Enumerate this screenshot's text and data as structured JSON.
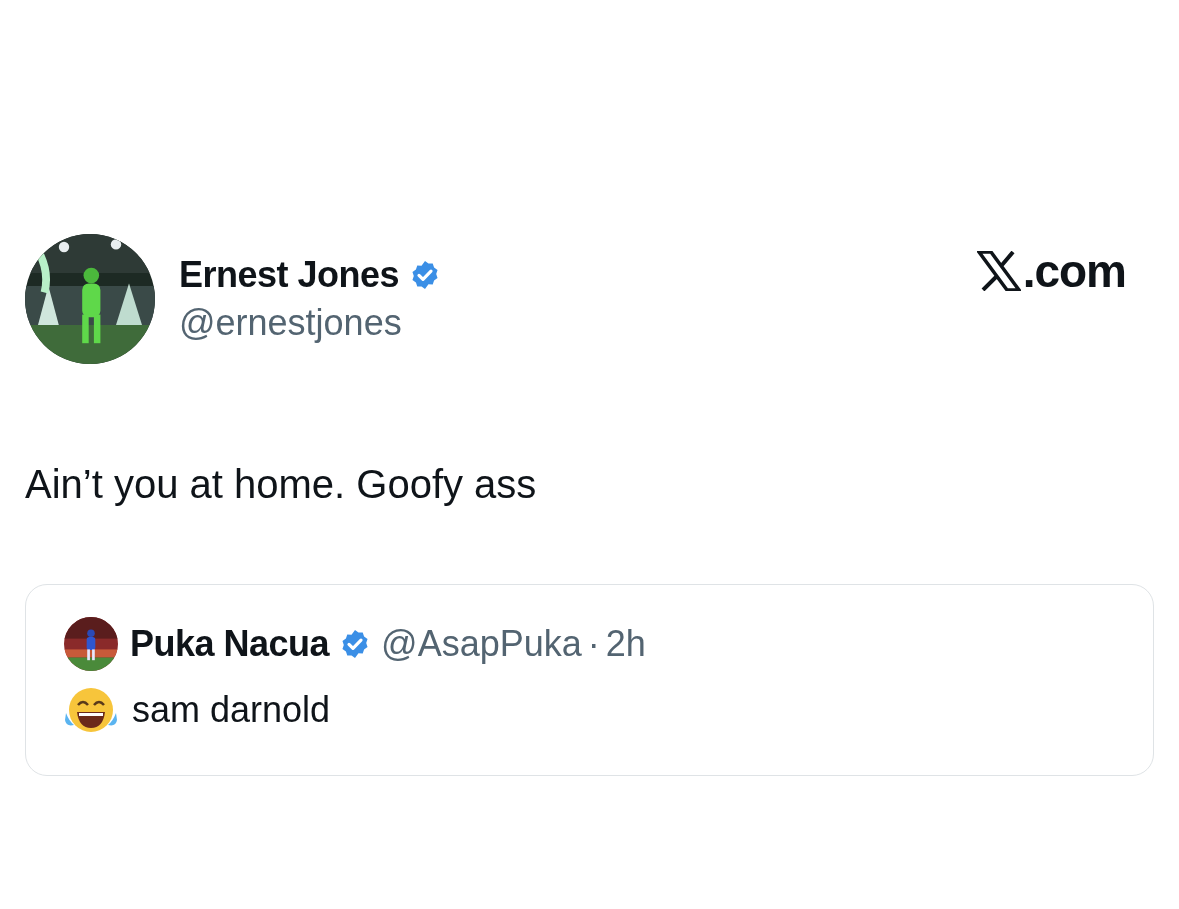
{
  "tweet": {
    "author": {
      "name": "Ernest Jones",
      "verified": true,
      "handle": "@ernestjones"
    },
    "site": {
      "suffix": ".com"
    },
    "text": "Ain’t you at home. Goofy ass",
    "quoted": {
      "author": {
        "name": "Puka Nacua",
        "verified": true,
        "handle": "@AsapPuka"
      },
      "separator": "·",
      "time": "2h",
      "text": "sam darnold"
    }
  }
}
